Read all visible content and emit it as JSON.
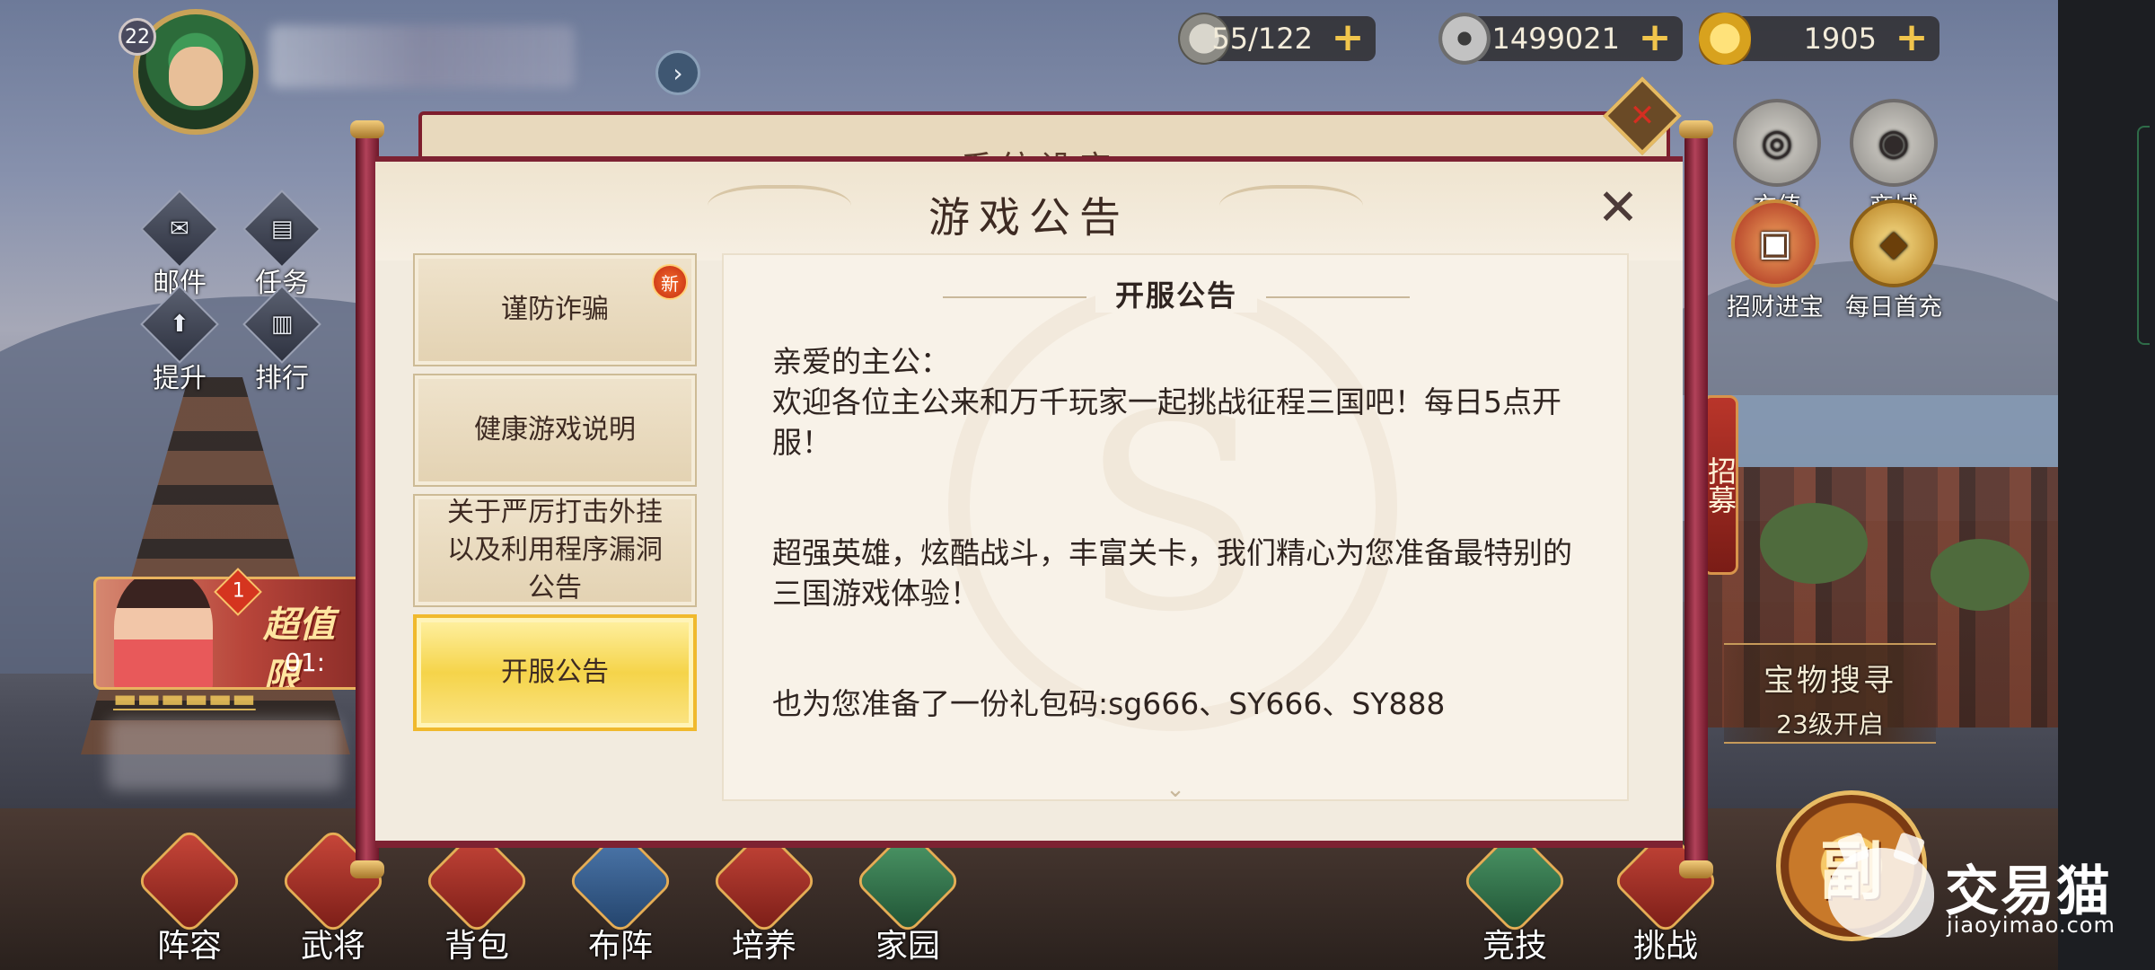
{
  "player": {
    "level": "22"
  },
  "resources": [
    {
      "icon": "stamina-icon",
      "value": "55/122"
    },
    {
      "icon": "copper-coin-icon",
      "value": "1499021"
    },
    {
      "icon": "gold-ingot-icon",
      "value": "1905"
    }
  ],
  "side_menu": {
    "mail": "邮件",
    "tasks": "任务",
    "upgrade": "提升",
    "ranking": "排行"
  },
  "right_menu": {
    "recharge": "充值",
    "shop": "商城",
    "fortune": "招财进宝",
    "daily_first": "每日首充",
    "recruit": "招募",
    "treasure_title": "宝物搜寻",
    "treasure_unlock": "23级开启"
  },
  "promo": {
    "title": "超值限",
    "timer": "01:",
    "badge": "1"
  },
  "bottom_nav": [
    "阵容",
    "武将",
    "背包",
    "布阵",
    "培养",
    "家园",
    "竞技",
    "挑战"
  ],
  "dungeon_button": "副",
  "background_dialog_title": "系统设定",
  "dialog": {
    "title": "游戏公告",
    "tabs": [
      {
        "label": "谨防诈骗",
        "badge": "新",
        "active": false
      },
      {
        "label": "健康游戏说明",
        "badge": null,
        "active": false
      },
      {
        "label": "关于严厉打击外挂以及利用程序漏洞公告",
        "badge": null,
        "active": false
      },
      {
        "label": "开服公告",
        "badge": null,
        "active": true
      }
    ],
    "content": {
      "header": "开服公告",
      "greeting": "亲爱的主公：",
      "para1": "欢迎各位主公来和万千玩家一起挑战征程三国吧！每日5点开服！",
      "para2": "超强英雄，炫酷战斗，丰富关卡，我们精心为您准备最特别的三国游戏体验！",
      "para3": "也为您准备了一份礼包码:sg666、SY666、SY888"
    }
  },
  "watermark": {
    "cn": "交易猫",
    "en": "jiaoyimao.com"
  }
}
